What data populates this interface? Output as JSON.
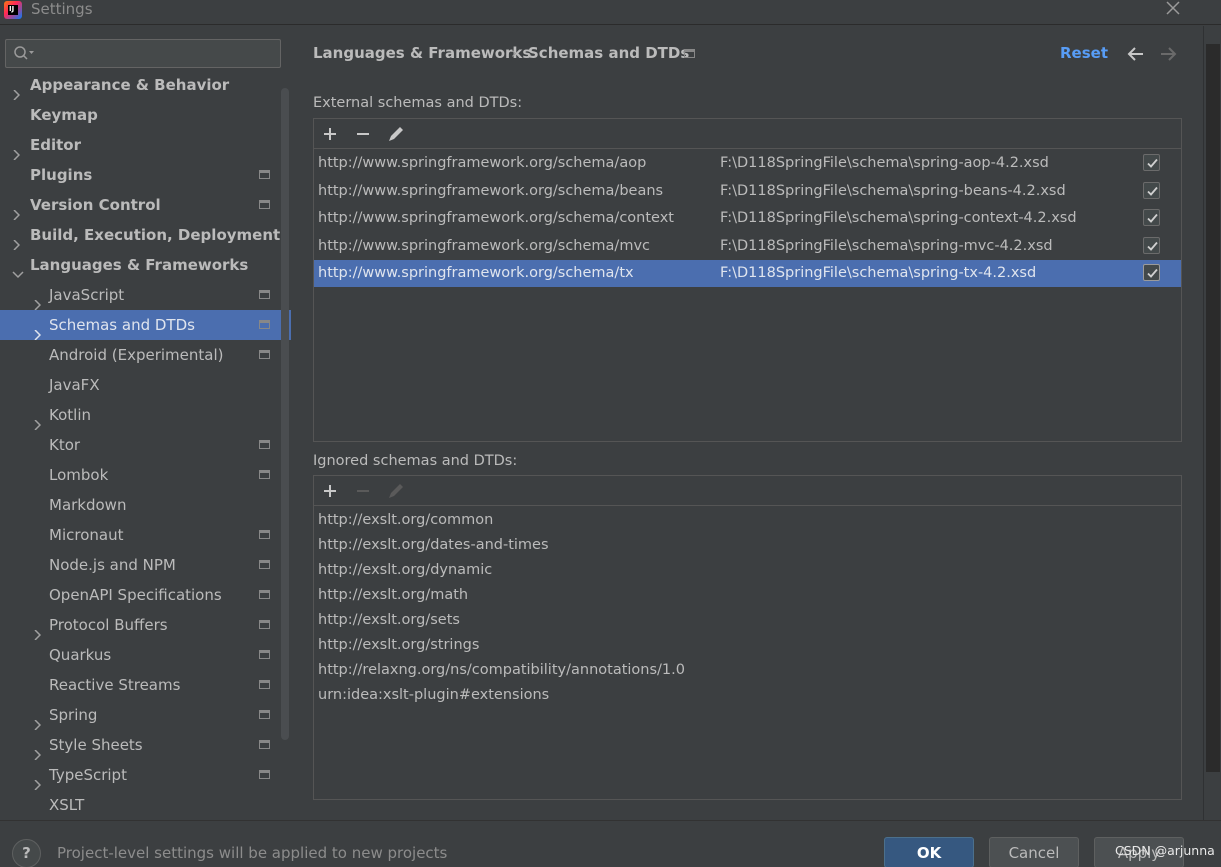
{
  "window": {
    "title": "Settings"
  },
  "search": {
    "placeholder": ""
  },
  "sidebar": {
    "items": [
      {
        "label": "Appearance & Behavior",
        "bold": true,
        "chevron": "right",
        "indent": 0,
        "project": false
      },
      {
        "label": "Keymap",
        "bold": true,
        "chevron": "",
        "indent": 0,
        "project": false
      },
      {
        "label": "Editor",
        "bold": true,
        "chevron": "right",
        "indent": 0,
        "project": false
      },
      {
        "label": "Plugins",
        "bold": true,
        "chevron": "",
        "indent": 0,
        "project": true
      },
      {
        "label": "Version Control",
        "bold": true,
        "chevron": "right",
        "indent": 0,
        "project": true
      },
      {
        "label": "Build, Execution, Deployment",
        "bold": true,
        "chevron": "right",
        "indent": 0,
        "project": false
      },
      {
        "label": "Languages & Frameworks",
        "bold": true,
        "chevron": "down",
        "indent": 0,
        "project": false
      },
      {
        "label": "JavaScript",
        "bold": false,
        "chevron": "right",
        "indent": 1,
        "project": true
      },
      {
        "label": "Schemas and DTDs",
        "bold": false,
        "chevron": "right",
        "indent": 1,
        "project": true,
        "selected": true
      },
      {
        "label": "Android (Experimental)",
        "bold": false,
        "chevron": "",
        "indent": 1,
        "project": true
      },
      {
        "label": "JavaFX",
        "bold": false,
        "chevron": "",
        "indent": 1,
        "project": false
      },
      {
        "label": "Kotlin",
        "bold": false,
        "chevron": "right",
        "indent": 1,
        "project": false
      },
      {
        "label": "Ktor",
        "bold": false,
        "chevron": "",
        "indent": 1,
        "project": true
      },
      {
        "label": "Lombok",
        "bold": false,
        "chevron": "",
        "indent": 1,
        "project": true
      },
      {
        "label": "Markdown",
        "bold": false,
        "chevron": "",
        "indent": 1,
        "project": false
      },
      {
        "label": "Micronaut",
        "bold": false,
        "chevron": "",
        "indent": 1,
        "project": true
      },
      {
        "label": "Node.js and NPM",
        "bold": false,
        "chevron": "",
        "indent": 1,
        "project": true
      },
      {
        "label": "OpenAPI Specifications",
        "bold": false,
        "chevron": "",
        "indent": 1,
        "project": true
      },
      {
        "label": "Protocol Buffers",
        "bold": false,
        "chevron": "right",
        "indent": 1,
        "project": true
      },
      {
        "label": "Quarkus",
        "bold": false,
        "chevron": "",
        "indent": 1,
        "project": true
      },
      {
        "label": "Reactive Streams",
        "bold": false,
        "chevron": "",
        "indent": 1,
        "project": true
      },
      {
        "label": "Spring",
        "bold": false,
        "chevron": "right",
        "indent": 1,
        "project": true
      },
      {
        "label": "Style Sheets",
        "bold": false,
        "chevron": "right",
        "indent": 1,
        "project": true
      },
      {
        "label": "TypeScript",
        "bold": false,
        "chevron": "right",
        "indent": 1,
        "project": true
      },
      {
        "label": "XSLT",
        "bold": false,
        "chevron": "",
        "indent": 1,
        "project": false
      }
    ]
  },
  "header": {
    "breadcrumb_parent": "Languages & Frameworks",
    "breadcrumb_separator": "›",
    "breadcrumb_current": "Schemas and DTDs",
    "reset_label": "Reset"
  },
  "external": {
    "label": "External schemas and DTDs:",
    "rows": [
      {
        "uri": "http://www.springframework.org/schema/aop",
        "path": "F:\\D118SpringFile\\schema\\spring-aop-4.2.xsd",
        "checked": true
      },
      {
        "uri": "http://www.springframework.org/schema/beans",
        "path": "F:\\D118SpringFile\\schema\\spring-beans-4.2.xsd",
        "checked": true
      },
      {
        "uri": "http://www.springframework.org/schema/context",
        "path": "F:\\D118SpringFile\\schema\\spring-context-4.2.xsd",
        "checked": true
      },
      {
        "uri": "http://www.springframework.org/schema/mvc",
        "path": "F:\\D118SpringFile\\schema\\spring-mvc-4.2.xsd",
        "checked": true
      },
      {
        "uri": "http://www.springframework.org/schema/tx",
        "path": "F:\\D118SpringFile\\schema\\spring-tx-4.2.xsd",
        "checked": true,
        "selected": true
      }
    ]
  },
  "ignored": {
    "label": "Ignored schemas and DTDs:",
    "rows": [
      "http://exslt.org/common",
      "http://exslt.org/dates-and-times",
      "http://exslt.org/dynamic",
      "http://exslt.org/math",
      "http://exslt.org/sets",
      "http://exslt.org/strings",
      "http://relaxng.org/ns/compatibility/annotations/1.0",
      "urn:idea:xslt-plugin#extensions"
    ]
  },
  "footer": {
    "help_label": "?",
    "hint": "Project-level settings will be applied to new projects",
    "ok_label": "OK",
    "cancel_label": "Cancel",
    "apply_label": "Apply",
    "watermark": "CSDN @arjunna"
  },
  "colors": {
    "background": "#3c3f41",
    "selection": "#4b6eaf",
    "link": "#589df6",
    "ok_button": "#365880"
  }
}
